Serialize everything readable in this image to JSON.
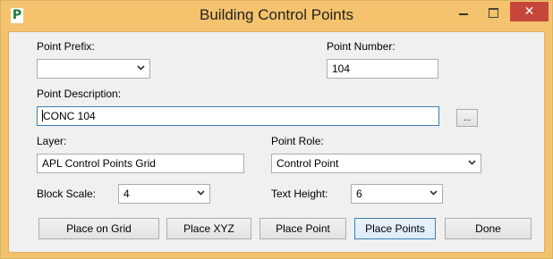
{
  "window": {
    "title": "Building Control Points",
    "app_icon_letter": "P",
    "close_glyph": "✕"
  },
  "form": {
    "point_prefix": {
      "label": "Point Prefix:",
      "value": ""
    },
    "point_number": {
      "label": "Point Number:",
      "value": "104"
    },
    "point_description": {
      "label": "Point Description:",
      "value": "CONC 104",
      "browse_label": "..."
    },
    "layer": {
      "label": "Layer:",
      "value": "APL Control Points Grid"
    },
    "point_role": {
      "label": "Point Role:",
      "value": "Control Point"
    },
    "block_scale": {
      "label": "Block Scale:",
      "value": "4"
    },
    "text_height": {
      "label": "Text Height:",
      "value": "6"
    }
  },
  "buttons": {
    "place_on_grid": "Place on Grid",
    "place_xyz": "Place XYZ",
    "place_point": "Place Point",
    "place_points": "Place Points",
    "done": "Done"
  },
  "colors": {
    "titlebar": "#f5c36e",
    "close_button": "#c7463b",
    "focus_border": "#3c7fb1"
  },
  "icons": {
    "app": "p-logo-icon",
    "minimize": "minimize-icon",
    "maximize": "maximize-icon",
    "close": "close-icon",
    "dropdown": "chevron-down-icon"
  }
}
